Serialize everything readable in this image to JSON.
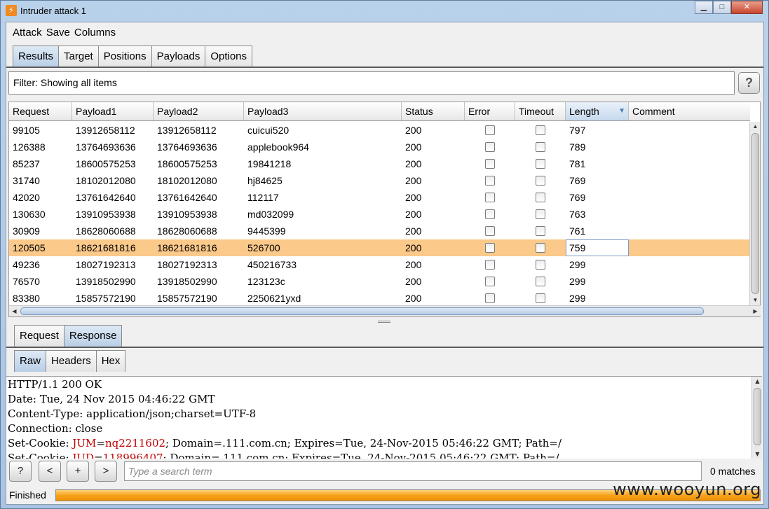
{
  "window": {
    "title": "Intruder attack 1",
    "min_glyph": "▁",
    "max_glyph": "□",
    "close_glyph": "✕"
  },
  "menu": [
    "Attack",
    "Save",
    "Columns"
  ],
  "main_tabs": [
    {
      "label": "Results",
      "active": true
    },
    {
      "label": "Target",
      "active": false
    },
    {
      "label": "Positions",
      "active": false
    },
    {
      "label": "Payloads",
      "active": false
    },
    {
      "label": "Options",
      "active": false
    }
  ],
  "filter": {
    "text": "Filter: Showing all items",
    "help_label": "?"
  },
  "table": {
    "columns": [
      "Request",
      "Payload1",
      "Payload2",
      "Payload3",
      "Status",
      "Error",
      "Timeout",
      "Length",
      "Comment"
    ],
    "sorted_column": "Length",
    "rows": [
      {
        "request": "99105",
        "payload1": "13912658112",
        "payload2": "13912658112",
        "payload3": "cuicui520",
        "status": "200",
        "error": false,
        "timeout": false,
        "length": "797",
        "comment": ""
      },
      {
        "request": "126388",
        "payload1": "13764693636",
        "payload2": "13764693636",
        "payload3": "applebook964",
        "status": "200",
        "error": false,
        "timeout": false,
        "length": "789",
        "comment": ""
      },
      {
        "request": "85237",
        "payload1": "18600575253",
        "payload2": "18600575253",
        "payload3": "19841218",
        "status": "200",
        "error": false,
        "timeout": false,
        "length": "781",
        "comment": ""
      },
      {
        "request": "31740",
        "payload1": "18102012080",
        "payload2": "18102012080",
        "payload3": "hj84625",
        "status": "200",
        "error": false,
        "timeout": false,
        "length": "769",
        "comment": ""
      },
      {
        "request": "42020",
        "payload1": "13761642640",
        "payload2": "13761642640",
        "payload3": "112117",
        "status": "200",
        "error": false,
        "timeout": false,
        "length": "769",
        "comment": ""
      },
      {
        "request": "130630",
        "payload1": "13910953938",
        "payload2": "13910953938",
        "payload3": "md032099",
        "status": "200",
        "error": false,
        "timeout": false,
        "length": "763",
        "comment": ""
      },
      {
        "request": "30909",
        "payload1": "18628060688",
        "payload2": "18628060688",
        "payload3": "9445399",
        "status": "200",
        "error": false,
        "timeout": false,
        "length": "761",
        "comment": ""
      },
      {
        "request": "120505",
        "payload1": "18621681816",
        "payload2": "18621681816",
        "payload3": "526700",
        "status": "200",
        "error": false,
        "timeout": false,
        "length": "759",
        "comment": "",
        "selected": true
      },
      {
        "request": "49236",
        "payload1": "18027192313",
        "payload2": "18027192313",
        "payload3": "450216733",
        "status": "200",
        "error": false,
        "timeout": false,
        "length": "299",
        "comment": ""
      },
      {
        "request": "76570",
        "payload1": "13918502990",
        "payload2": "13918502990",
        "payload3": "123123c",
        "status": "200",
        "error": false,
        "timeout": false,
        "length": "299",
        "comment": ""
      },
      {
        "request": "83380",
        "payload1": "15857572190",
        "payload2": "15857572190",
        "payload3": "2250621yxd",
        "status": "200",
        "error": false,
        "timeout": false,
        "length": "299",
        "comment": ""
      }
    ]
  },
  "detail_tabs": [
    {
      "label": "Request",
      "active": false
    },
    {
      "label": "Response",
      "active": true
    }
  ],
  "view_tabs": [
    {
      "label": "Raw",
      "active": true
    },
    {
      "label": "Headers",
      "active": false
    },
    {
      "label": "Hex",
      "active": false
    }
  ],
  "response": {
    "status_line": "HTTP/1.1 200 OK",
    "date_line": "Date: Tue, 24 Nov 2015 04:46:22 GMT",
    "content_type_line": "Content-Type: application/json;charset=UTF-8",
    "connection_line": "Connection: close",
    "cookie1": {
      "prefix": "Set-Cookie: ",
      "name": "JUM",
      "eq": "=",
      "value": "nq2211602",
      "suffix": "; Domain=.111.com.cn; Expires=Tue, 24-Nov-2015 05:46:22 GMT; Path=/"
    },
    "cookie2": {
      "prefix": "Set-Cookie: ",
      "name": "JUD",
      "eq": "=",
      "value": "118996407",
      "suffix": "; Domain=.111.com.cn; Expires=Tue, 24-Nov-2015 05:46:22 GMT; Path=/"
    }
  },
  "search": {
    "help_label": "?",
    "prev_label": "<",
    "add_label": "+",
    "next_label": ">",
    "placeholder": "Type a search term",
    "matches": "0 matches"
  },
  "status": {
    "text": "Finished",
    "progress": 1.0
  },
  "watermark": "www.wooyun.org",
  "colors": {
    "selected_row": "#fbc98a",
    "progress": "#f7a21a",
    "cookie_highlight": "#c00000"
  }
}
